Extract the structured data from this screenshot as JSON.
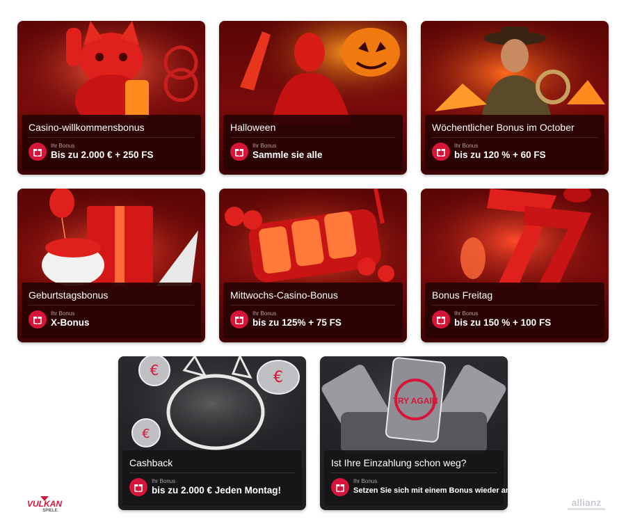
{
  "bonus_label": "Ihr Bonus",
  "cards": [
    {
      "title": "Casino-willkommensbonus",
      "value": "Bis zu 2.000 € + 250 FS"
    },
    {
      "title": "Halloween",
      "value": "Sammle sie alle"
    },
    {
      "title": "Wöchentlicher Bonus im October",
      "value": "bis zu 120 % + 60 FS"
    },
    {
      "title": "Geburtstagsbonus",
      "value": "X-Bonus"
    },
    {
      "title": "Mittwochs-Casino-Bonus",
      "value": "bis zu 125% + 75 FS"
    },
    {
      "title": "Bonus Freitag",
      "value": "bis zu 150 % + 100 FS"
    },
    {
      "title": "Cashback",
      "value": "bis zu 2.000 € Jeden Montag!"
    },
    {
      "title": "Ist Ihre Einzahlung schon weg?",
      "value": "Setzen Sie sich mit einem Bonus wieder an"
    }
  ],
  "art_labels": {
    "try_again": "TRY AGAIN"
  },
  "logos": {
    "left": "VULKAN",
    "left_sub": "SPIELE",
    "right": "allianz"
  },
  "colors": {
    "accent": "#d7143a",
    "card_red": "#6a0909",
    "card_dark": "#222225"
  }
}
